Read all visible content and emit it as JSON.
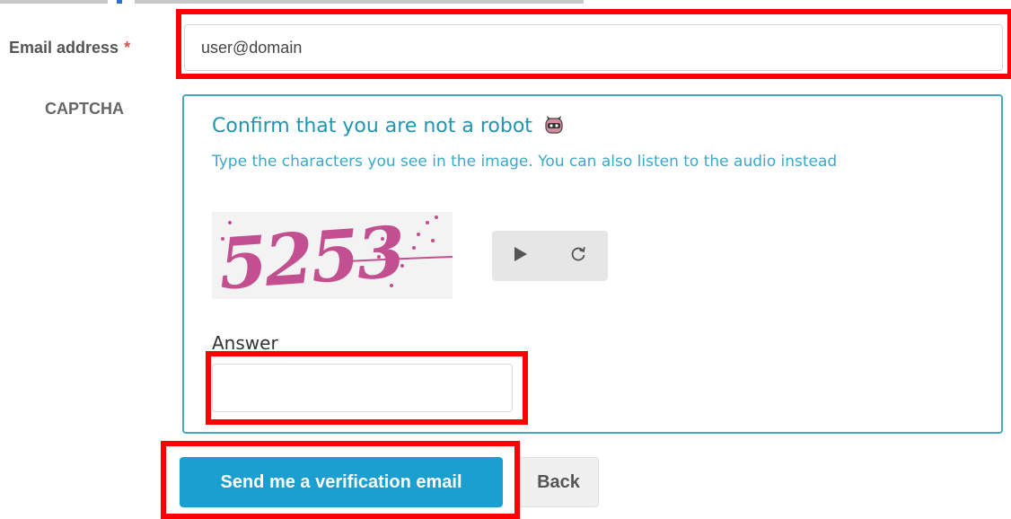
{
  "form": {
    "email_label": "Email address",
    "required_mark": "*",
    "email_value": "user@domain",
    "captcha_label": "CAPTCHA"
  },
  "captcha": {
    "title": "Confirm that you are not a robot",
    "subtitle": "Type the characters you see in the image. You can also listen to the audio instead",
    "image_text": "5253",
    "answer_label": "Answer",
    "answer_value": ""
  },
  "actions": {
    "send_label": "Send me a verification email",
    "back_label": "Back"
  },
  "colors": {
    "accent": "#1b9fd0",
    "captcha_border": "#46a7c0",
    "captcha_text": "#c24f8f",
    "highlight": "#ff0000"
  },
  "icons": [
    "robot-icon",
    "play-icon",
    "refresh-icon"
  ]
}
